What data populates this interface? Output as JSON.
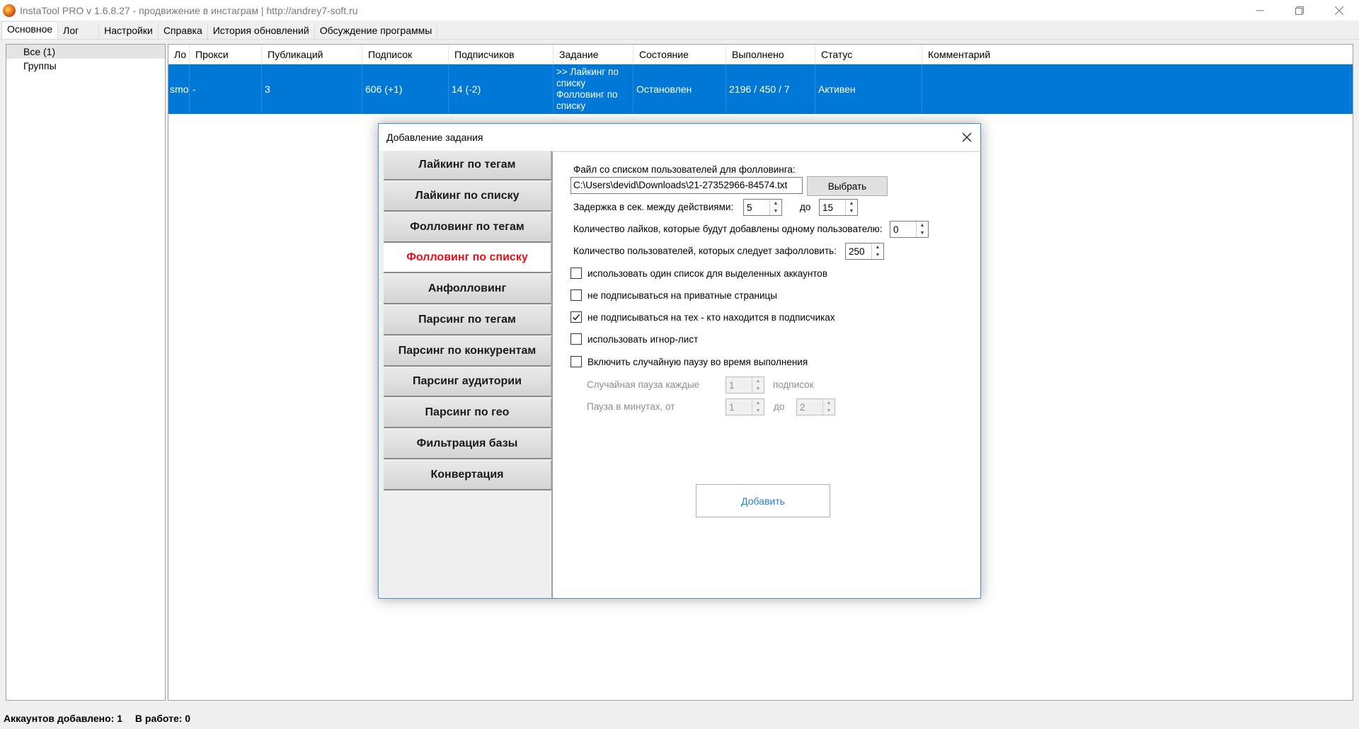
{
  "window": {
    "title": "InstaTool PRO v 1.6.8.27 - продвижение в инстаграм | http://andrey7-soft.ru"
  },
  "menu_tabs": [
    "Основное",
    "Лог",
    "Настройки",
    "Справка",
    "История обновлений",
    "Обсуждение программы"
  ],
  "groups": [
    "Все (1)",
    "Группы"
  ],
  "table": {
    "columns": [
      "Ло",
      "Прокси",
      "Публикаций",
      "Подписок",
      "Подписчиков",
      "Задание",
      "Состояние",
      "Выполнено",
      "Статус",
      "Комментарий"
    ],
    "rows": [
      {
        "login": "smo",
        "proxy": "-",
        "posts": "3",
        "following": "606 (+1)",
        "followers": "14 (-2)",
        "task": ">> Лайкинг по списку Фолловинг по списку",
        "state": "Остановлен",
        "done": "2196 / 450 / 7",
        "status": "Активен",
        "comment": ""
      }
    ]
  },
  "status_bar": {
    "accounts": "Аккаунтов добавлено: 1",
    "working": "В работе: 0"
  },
  "dialog": {
    "title": "Добавление задания",
    "tasks": [
      "Лайкинг по тегам",
      "Лайкинг по списку",
      "Фолловинг по тегам",
      "Фолловинг по списку",
      "Анфолловинг",
      "Парсинг по тегам",
      "Парсинг по конкурентам",
      "Парсинг аудитории",
      "Парсинг по гео",
      "Фильтрация базы",
      "Конвертация"
    ],
    "active_task": "Фолловинг по списку",
    "file_label": "Файл со списком пользователей для фолловинга:",
    "file_path": "C:\\Users\\devid\\Downloads\\21-27352966-84574.txt",
    "browse_button": "Выбрать",
    "delay_label": "Задержка в сек. между действиями:",
    "delay_from": "5",
    "delay_to_label": "до",
    "delay_to": "15",
    "likes_label": "Количество лайков, которые будут добавлены одному пользователю:",
    "likes_value": "0",
    "users_label": "Количество пользователей, которых следует зафолловить:",
    "users_value": "250",
    "checkboxes": [
      {
        "label": "использовать один список для выделенных аккаунтов",
        "checked": false
      },
      {
        "label": "не подписываться на приватные страницы",
        "checked": false
      },
      {
        "label": "не подписываться на тех - кто находится в подписчиках",
        "checked": true
      },
      {
        "label": "использовать игнор-лист",
        "checked": false
      },
      {
        "label": "Включить случайную паузу во время выполнения",
        "checked": false
      }
    ],
    "pause_every_label": "Случайная пауза каждые",
    "pause_every_value": "1",
    "pause_every_unit": "подписок",
    "pause_minutes_label": "Пауза в минутах, от",
    "pause_from": "1",
    "pause_to_label": "до",
    "pause_to": "2",
    "add_button": "Добавить"
  },
  "colors": {
    "selection": "#0078d7",
    "active_task": "#e8101a",
    "add_button_text": "#1e7fd4"
  }
}
